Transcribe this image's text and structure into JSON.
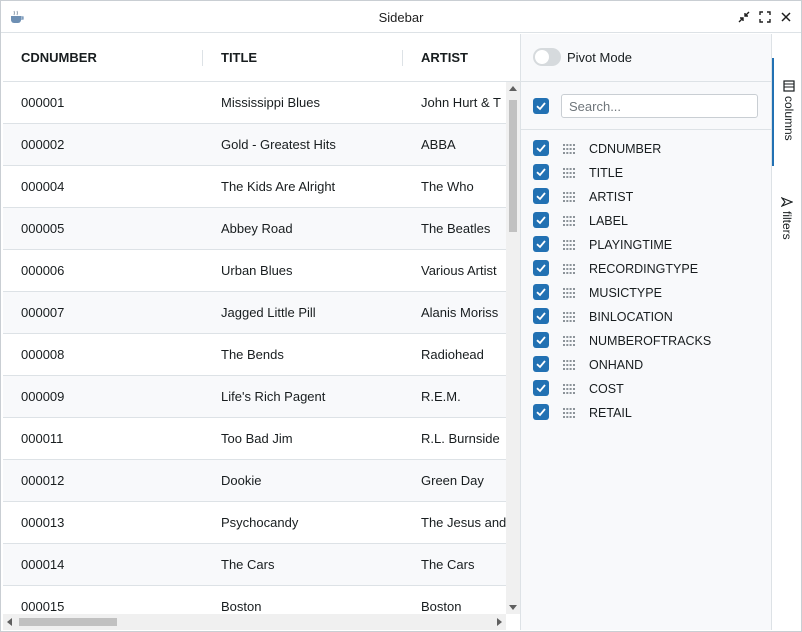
{
  "window": {
    "title": "Sidebar"
  },
  "grid": {
    "columns": [
      "CDNUMBER",
      "TITLE",
      "ARTIST"
    ],
    "rows": [
      [
        "000001",
        "Mississippi Blues",
        "John Hurt & T"
      ],
      [
        "000002",
        "Gold - Greatest Hits",
        "ABBA"
      ],
      [
        "000004",
        "The Kids Are Alright",
        "The Who"
      ],
      [
        "000005",
        "Abbey Road",
        "The Beatles"
      ],
      [
        "000006",
        "Urban Blues",
        "Various Artist"
      ],
      [
        "000007",
        "Jagged Little Pill",
        "Alanis Moriss"
      ],
      [
        "000008",
        "The Bends",
        "Radiohead"
      ],
      [
        "000009",
        "Life's Rich Pagent",
        "R.E.M."
      ],
      [
        "000011",
        "Too Bad Jim",
        "R.L. Burnside"
      ],
      [
        "000012",
        "Dookie",
        "Green Day"
      ],
      [
        "000013",
        "Psychocandy",
        "The Jesus and"
      ],
      [
        "000014",
        "The Cars",
        "The Cars"
      ],
      [
        "000015",
        "Boston",
        "Boston"
      ]
    ]
  },
  "toolpanel": {
    "pivot_label": "Pivot Mode",
    "pivot_on": false,
    "search_placeholder": "Search...",
    "columns": [
      {
        "label": "CDNUMBER",
        "checked": true
      },
      {
        "label": "TITLE",
        "checked": true
      },
      {
        "label": "ARTIST",
        "checked": true
      },
      {
        "label": "LABEL",
        "checked": true
      },
      {
        "label": "PLAYINGTIME",
        "checked": true
      },
      {
        "label": "RECORDINGTYPE",
        "checked": true
      },
      {
        "label": "MUSICTYPE",
        "checked": true
      },
      {
        "label": "BINLOCATION",
        "checked": true
      },
      {
        "label": "NUMBEROFTRACKS",
        "checked": true
      },
      {
        "label": "ONHAND",
        "checked": true
      },
      {
        "label": "COST",
        "checked": true
      },
      {
        "label": "RETAIL",
        "checked": true
      }
    ]
  },
  "sidetabs": {
    "columns_label": "columns",
    "filters_label": "filters"
  },
  "colors": {
    "accent": "#2271b3",
    "row_alt": "#f8f9fb",
    "border": "#dde2e6"
  }
}
